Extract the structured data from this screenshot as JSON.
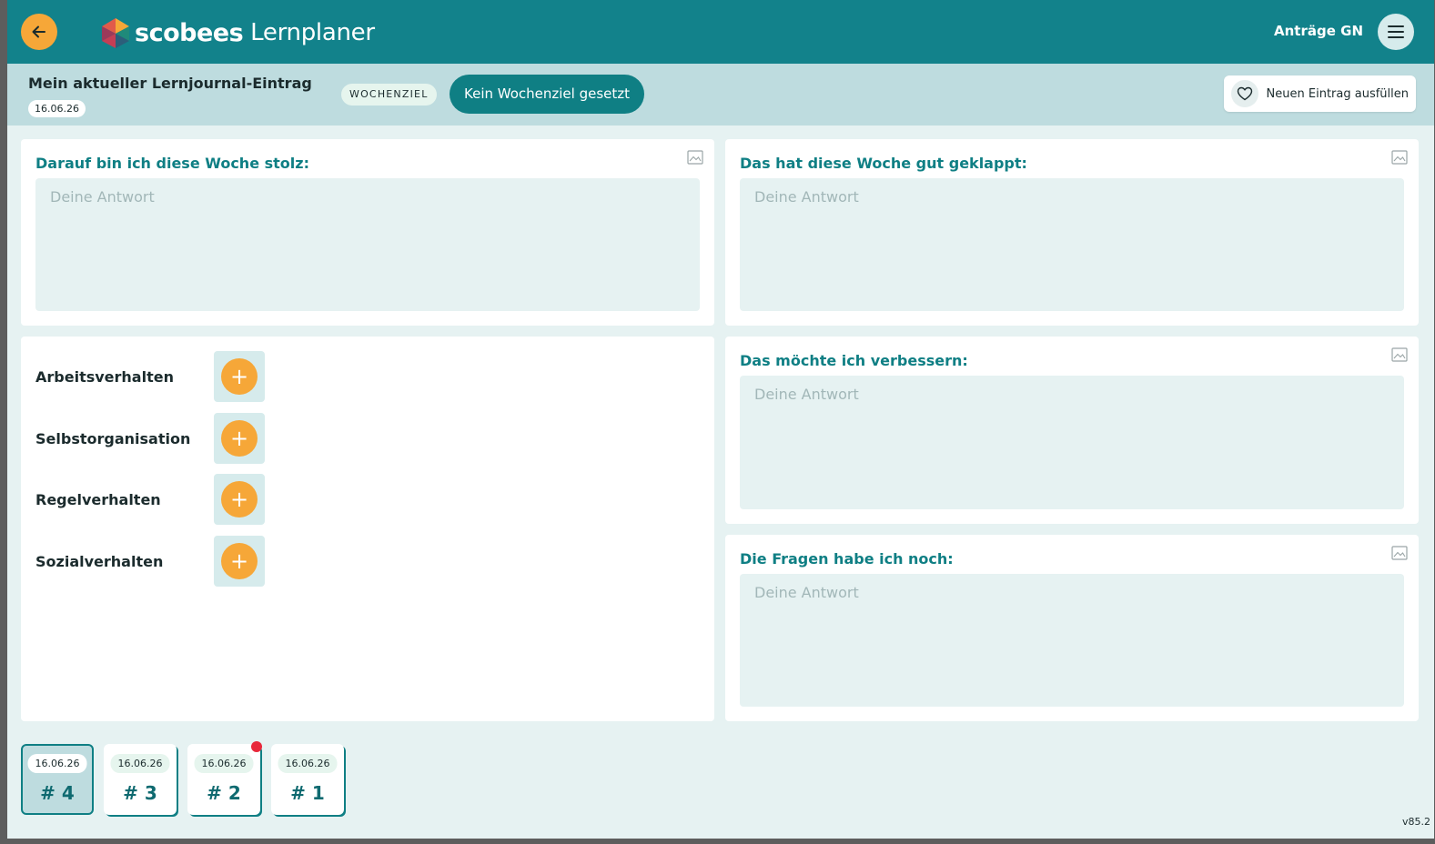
{
  "header": {
    "brand": "scobees",
    "product": "Lernplaner",
    "user_label": "Anträge GN"
  },
  "subheader": {
    "title": "Mein aktueller Lernjournal-Eintrag",
    "date": "16.06.26",
    "wochenziel_badge": "WOCHENZIEL",
    "wochenziel_value": "Kein Wochenziel gesetzt",
    "new_entry_label": "Neuen Eintrag ausfüllen"
  },
  "questions": [
    {
      "title": "Darauf bin ich diese Woche stolz:",
      "placeholder": "Deine Antwort"
    },
    {
      "title": "Das hat diese Woche gut geklappt:",
      "placeholder": "Deine Antwort"
    },
    {
      "title": "Das möchte ich verbessern:",
      "placeholder": "Deine Antwort"
    },
    {
      "title": "Die Fragen habe ich noch:",
      "placeholder": "Deine Antwort"
    }
  ],
  "behaviours": [
    {
      "label": "Arbeitsverhalten",
      "action": "+"
    },
    {
      "label": "Selbstorganisation",
      "action": "+"
    },
    {
      "label": "Regelverhalten",
      "action": "+"
    },
    {
      "label": "Sozialverhalten",
      "action": "+"
    }
  ],
  "entries": [
    {
      "date": "16.06.26",
      "number": "# 4",
      "active": true,
      "notification": false
    },
    {
      "date": "16.06.26",
      "number": "# 3",
      "active": false,
      "notification": false
    },
    {
      "date": "16.06.26",
      "number": "# 2",
      "active": false,
      "notification": true
    },
    {
      "date": "16.06.26",
      "number": "# 1",
      "active": false,
      "notification": false
    }
  ],
  "version": "v85.2",
  "colors": {
    "primary": "#12828b",
    "accent": "#f6a738",
    "surface": "#e6f2f2",
    "notification": "#e8283b"
  }
}
